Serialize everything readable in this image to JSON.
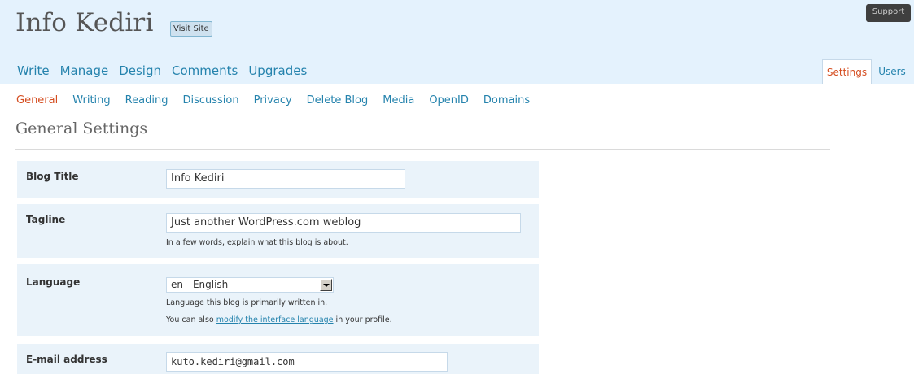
{
  "header": {
    "blog_title": "Info Kediri",
    "visit_site_label": "Visit Site",
    "support_label": "Support"
  },
  "main_nav": [
    "Write",
    "Manage",
    "Design",
    "Comments",
    "Upgrades"
  ],
  "tabs": {
    "settings": "Settings",
    "users": "Users"
  },
  "sub_nav": {
    "items": [
      "General",
      "Writing",
      "Reading",
      "Discussion",
      "Privacy",
      "Delete Blog",
      "Media",
      "OpenID",
      "Domains"
    ],
    "current": "General"
  },
  "page_title": "General Settings",
  "form": {
    "blog_title": {
      "label": "Blog Title",
      "value": "Info Kediri"
    },
    "tagline": {
      "label": "Tagline",
      "value": "Just another WordPress.com weblog",
      "hint": "In a few words, explain what this blog is about."
    },
    "language": {
      "label": "Language",
      "selected": "en - English",
      "hint": "Language this blog is primarily written in.",
      "hint2_prefix": "You can also ",
      "hint2_link": "modify the interface language",
      "hint2_suffix": " in your profile."
    },
    "email": {
      "label": "E-mail address",
      "value": "kuto.kediri@gmail.com"
    }
  },
  "colors": {
    "header_bg": "#e4f2fd",
    "link": "#2583ad",
    "current": "#d54e21",
    "row_bg": "#eaf3fa"
  }
}
